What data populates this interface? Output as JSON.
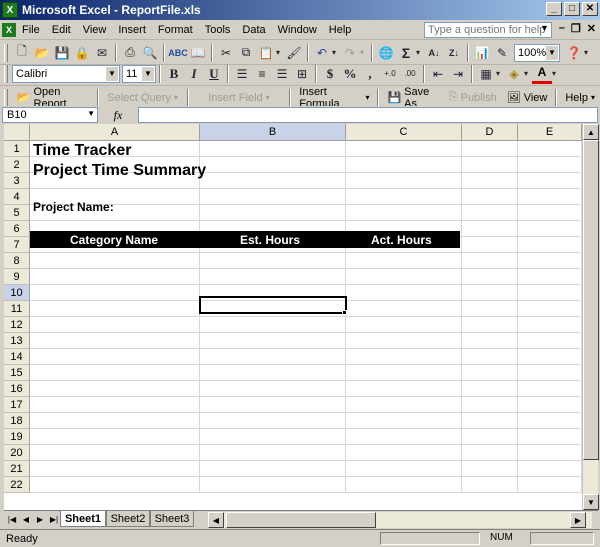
{
  "window": {
    "title": "Microsoft Excel - ReportFile.xls"
  },
  "menu": {
    "items": [
      "File",
      "Edit",
      "View",
      "Insert",
      "Format",
      "Tools",
      "Data",
      "Window",
      "Help"
    ],
    "help_placeholder": "Type a question for help"
  },
  "standard_toolbar": {
    "zoom": "100%"
  },
  "formatting_toolbar": {
    "font": "Calibri",
    "size": "11",
    "bold": "B",
    "italic": "I",
    "underline": "U",
    "currency": "$",
    "percent": "%",
    "comma": ","
  },
  "report_toolbar": {
    "open_report": "Open Report",
    "select_query": "Select Query",
    "insert_field": "Insert Field",
    "insert_formula": "Insert Formula",
    "save_as": "Save As",
    "publish": "Publish",
    "view": "View",
    "help": "Help"
  },
  "formula_bar": {
    "name_box": "B10",
    "fx": "fx",
    "value": ""
  },
  "columns": [
    "A",
    "B",
    "C",
    "D",
    "E"
  ],
  "rows": [
    "1",
    "2",
    "3",
    "4",
    "5",
    "6",
    "7",
    "8",
    "9",
    "10",
    "11",
    "12",
    "13",
    "14",
    "15",
    "16",
    "17",
    "18",
    "19",
    "20",
    "21",
    "22"
  ],
  "cells": {
    "a1": "Time Tracker",
    "a2": "Project Time Summary",
    "a4": "Project Name:",
    "header": {
      "category": "Category Name",
      "est": "Est. Hours",
      "act": "Act. Hours"
    }
  },
  "active_cell": "B10",
  "sheets": [
    {
      "name": "Sheet1",
      "active": true
    },
    {
      "name": "Sheet2",
      "active": false
    },
    {
      "name": "Sheet3",
      "active": false
    }
  ],
  "status": {
    "mode": "Ready",
    "num": "NUM"
  },
  "colors": {
    "title_start": "#0a246a",
    "title_end": "#a6caf0",
    "header_bg": "#000000",
    "header_text": "#ffffff",
    "selection": "#c8d2e8"
  }
}
